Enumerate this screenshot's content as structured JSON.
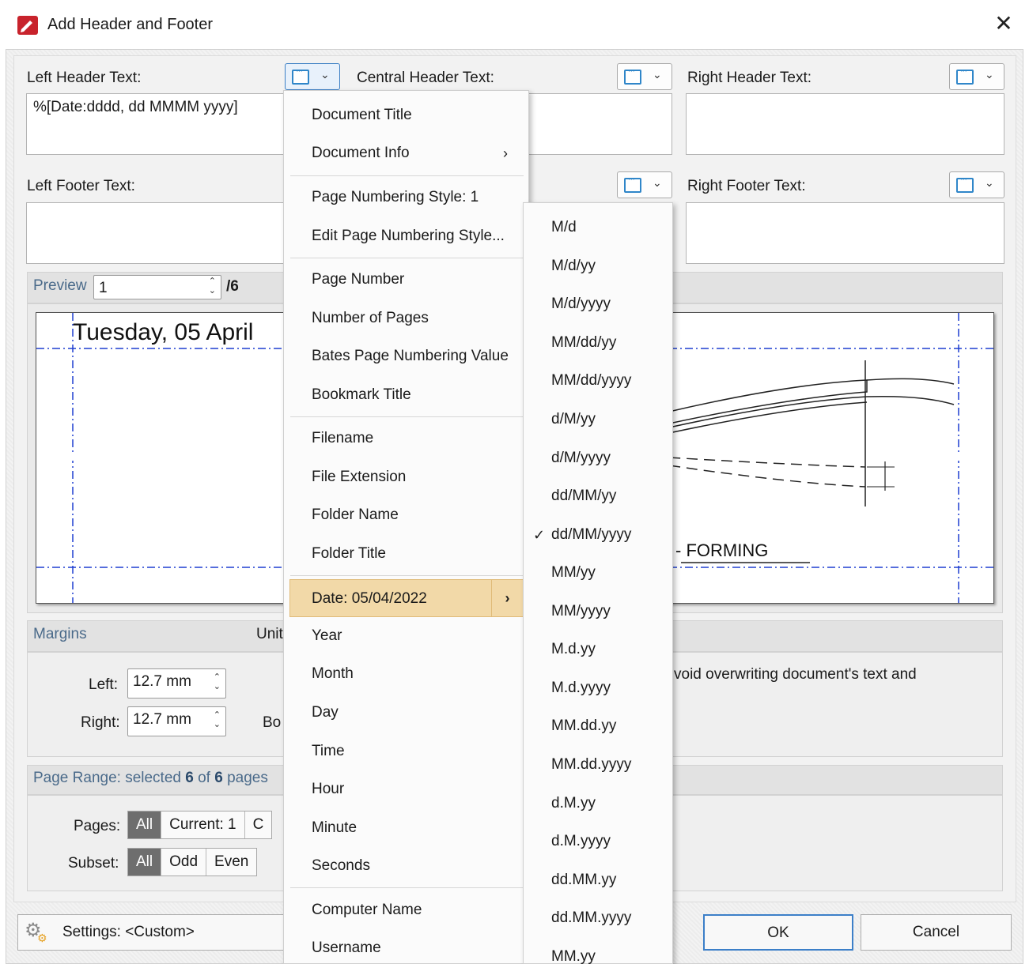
{
  "window": {
    "title": "Add Header and Footer",
    "close_symbol": "✕"
  },
  "header": {
    "left_label": "Left Header Text:",
    "left_value": "%[Date:dddd, dd MMMM yyyy]",
    "central_label": "Central Header Text:",
    "right_label": "Right Header Text:"
  },
  "footer": {
    "left_label": "Left Footer Text:",
    "right_label": "Right Footer Text:"
  },
  "preview": {
    "label": "Preview",
    "page_value": "1",
    "page_total": "/6",
    "header_text": "Tuesday, 05 April",
    "drawing_text": "- FORMING"
  },
  "margins": {
    "title": "Margins",
    "units_label": "Unit",
    "left_label": "Left:",
    "left_value": "12.7 mm",
    "right_label": "Right:",
    "right_value": "12.7 mm",
    "bottom_label": "Bo",
    "note": "void overwriting document's text and"
  },
  "page_range": {
    "title_prefix": "Page Range: selected ",
    "selected": "6",
    "of": " of ",
    "total": "6",
    "suffix": " pages",
    "pages_label": "Pages:",
    "pages_options": [
      "All",
      "Current: 1",
      "C"
    ],
    "subset_label": "Subset:",
    "subset_options": [
      "All",
      "Odd",
      "Even"
    ]
  },
  "bottom": {
    "settings_label": "Settings: <Custom>",
    "ok_label": "OK",
    "cancel_label": "Cancel"
  },
  "macro_menu": {
    "items": [
      "Document Title",
      "Document Info",
      "Page Numbering Style: 1",
      "Edit Page Numbering Style...",
      "Page Number",
      "Number of Pages",
      "Bates Page Numbering Value",
      "Bookmark Title",
      "Filename",
      "File Extension",
      "Folder Name",
      "Folder Title",
      "Date: 05/04/2022",
      "Year",
      "Month",
      "Day",
      "Time",
      "Hour",
      "Minute",
      "Seconds",
      "Computer Name",
      "Username"
    ],
    "highlighted_index": 12
  },
  "date_menu": {
    "items": [
      "M/d",
      "M/d/yy",
      "M/d/yyyy",
      "MM/dd/yy",
      "MM/dd/yyyy",
      "d/M/yy",
      "d/M/yyyy",
      "dd/MM/yy",
      "dd/MM/yyyy",
      "MM/yy",
      "MM/yyyy",
      "M.d.yy",
      "M.d.yyyy",
      "MM.dd.yy",
      "MM.dd.yyyy",
      "d.M.yy",
      "d.M.yyyy",
      "dd.MM.yy",
      "dd.MM.yyyy",
      "MM.yy"
    ],
    "checked_index": 8,
    "check_symbol": "✓"
  },
  "colors": {
    "accent": "#3c7fc8",
    "menu_highlight": "#f2d9a8",
    "guide_line": "#1f3fd0"
  }
}
